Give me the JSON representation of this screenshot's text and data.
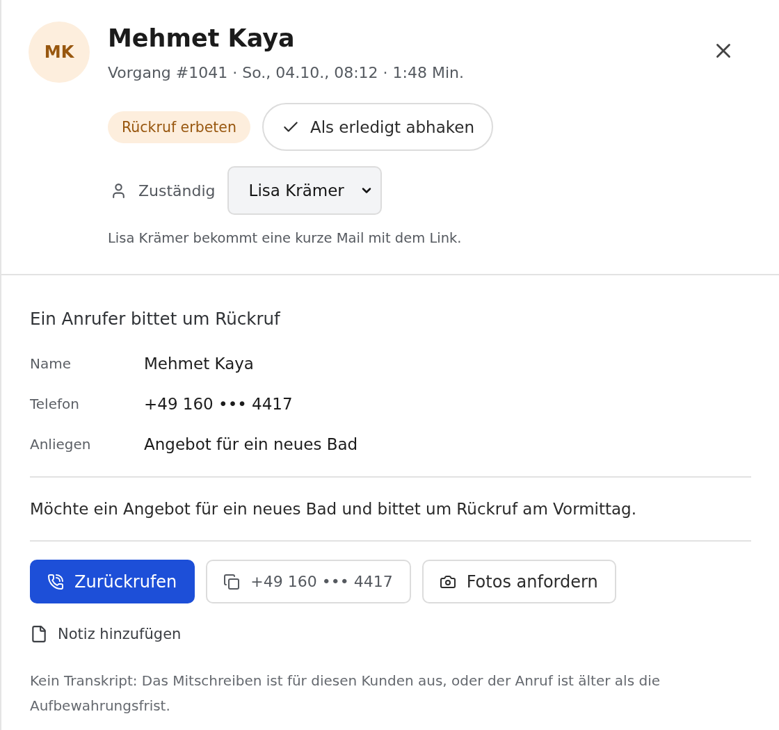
{
  "header": {
    "avatar": {
      "initials": "MK"
    },
    "name": "Mehmet Kaya",
    "subtitle": "Vorgang #1041 · So., 04.10., 08:12 · 1:48 Min.",
    "status_badge": "Rückruf erbeten",
    "done_button": "Als erledigt abhaken",
    "assignee": {
      "label": "Zuständig",
      "value": "Lisa Krämer"
    },
    "assignee_note": "Lisa Krämer bekommt eine kurze Mail mit dem Link."
  },
  "details": {
    "title": "Ein Anrufer bittet um Rückruf",
    "fields": [
      {
        "label": "Name",
        "value": "Mehmet Kaya"
      },
      {
        "label": "Telefon",
        "value": "+49 160 ••• 4417"
      },
      {
        "label": "Anliegen",
        "value": "Angebot für ein neues Bad"
      }
    ],
    "summary": "Möchte ein Angebot für ein neues Bad und bittet um Rückruf am Vormittag.",
    "actions": [
      {
        "kind": "call",
        "label": "Zurückrufen"
      },
      {
        "kind": "copy",
        "label": "+49 160 ••• 4417"
      },
      {
        "kind": "photo",
        "label": "Fotos anfordern"
      }
    ],
    "note_link": "Notiz hinzufügen",
    "transcript_note": "Kein Transkript: Das Mitschreiben ist für diesen Kunden aus, oder der Anruf ist älter als die Aufbewahrungsfrist."
  }
}
